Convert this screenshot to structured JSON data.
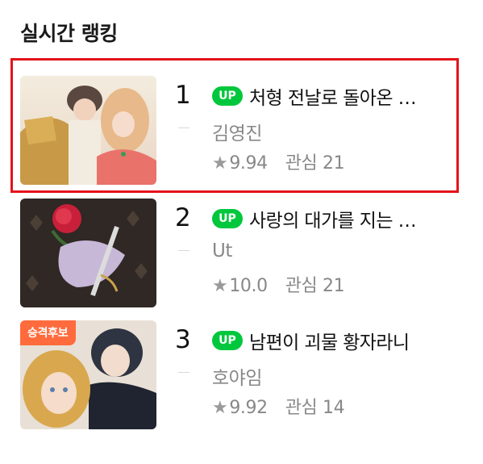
{
  "section": {
    "title": "실시간 랭킹"
  },
  "items": [
    {
      "rank": "1",
      "badge": "UP",
      "title": "처형 전날로 돌아온 …",
      "author": "김영진",
      "star": "★",
      "rating": "9.94",
      "interest_label": "관심",
      "interest_count": "21",
      "promo": ""
    },
    {
      "rank": "2",
      "badge": "UP",
      "title": "사랑의 대가를 지는 …",
      "author": "Ut",
      "star": "★",
      "rating": "10.0",
      "interest_label": "관심",
      "interest_count": "21",
      "promo": ""
    },
    {
      "rank": "3",
      "badge": "UP",
      "title": "남편이 괴물 황자라니",
      "author": "호야임",
      "star": "★",
      "rating": "9.92",
      "interest_label": "관심",
      "interest_count": "14",
      "promo": "승격후보"
    }
  ],
  "colors": {
    "highlight": "#e3131b",
    "up_badge": "#00c73c",
    "promo_badge": "#ff6b3d",
    "muted_text": "#888888"
  }
}
